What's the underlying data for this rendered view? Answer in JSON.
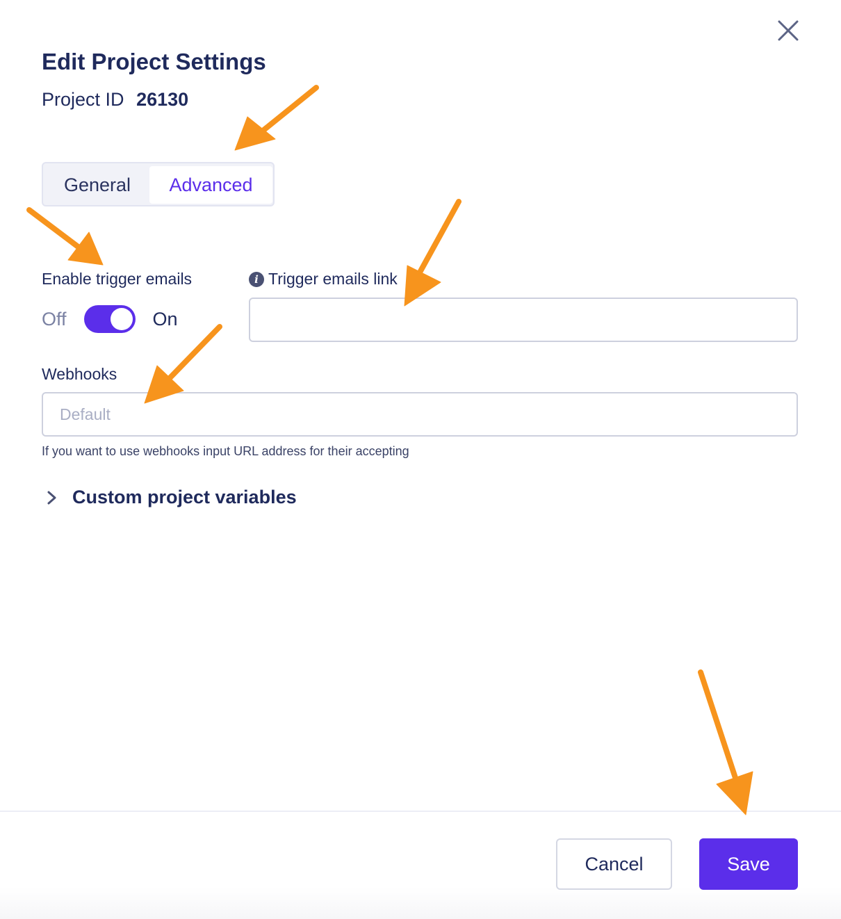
{
  "dialog": {
    "title": "Edit Project Settings",
    "project_id_label": "Project ID",
    "project_id_value": "26130",
    "close_icon": "close-icon"
  },
  "tabs": [
    {
      "label": "General",
      "active": false
    },
    {
      "label": "Advanced",
      "active": true
    }
  ],
  "trigger_emails": {
    "label": "Enable trigger emails",
    "off_label": "Off",
    "on_label": "On",
    "enabled": true
  },
  "trigger_link": {
    "label": "Trigger emails link",
    "icon": "info-icon",
    "value": ""
  },
  "webhooks": {
    "label": "Webhooks",
    "placeholder": "Default",
    "value": "",
    "hint": "If you want to use webhooks input URL address for their accepting"
  },
  "custom_variables": {
    "label": "Custom project variables",
    "icon": "chevron-right-icon"
  },
  "footer": {
    "cancel_label": "Cancel",
    "save_label": "Save"
  },
  "colors": {
    "accent": "#5b2eea",
    "text": "#1f2a5c",
    "annotation_arrow": "#f7941d"
  }
}
